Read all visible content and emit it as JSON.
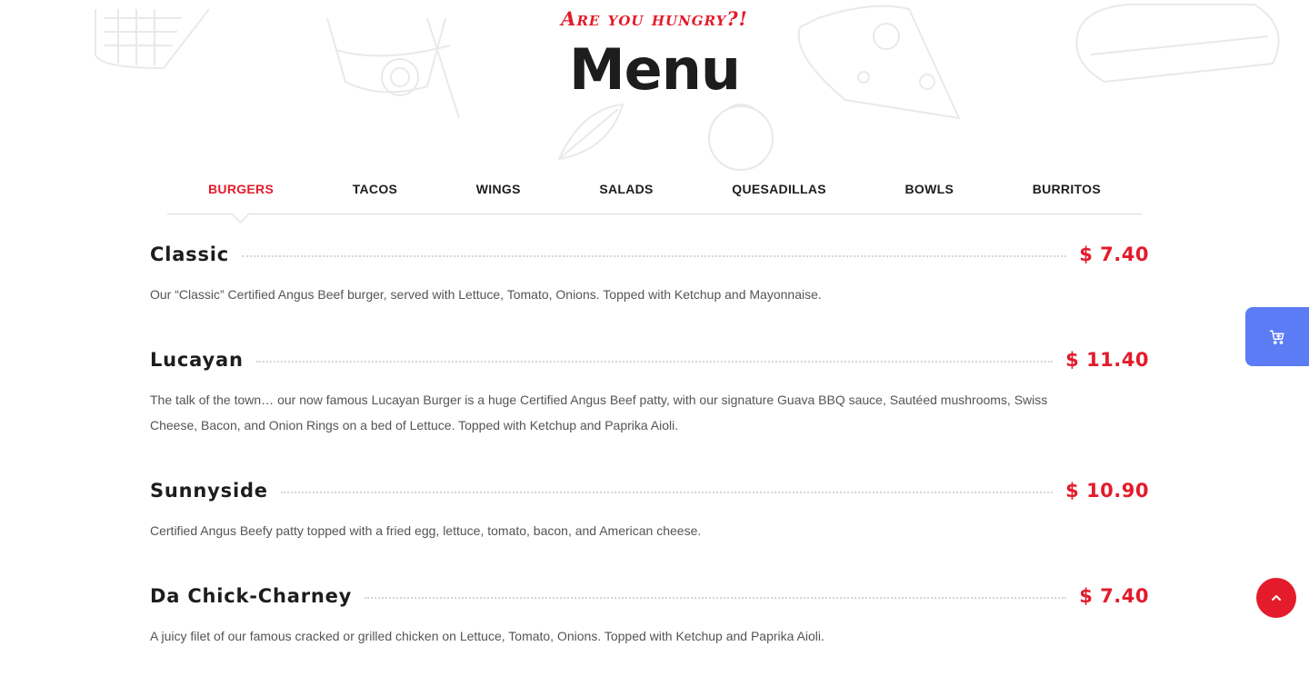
{
  "header": {
    "tagline": "Are you hungry?!",
    "title": "Menu"
  },
  "tabs": [
    {
      "label": "BURGERS",
      "active": true
    },
    {
      "label": "TACOS",
      "active": false
    },
    {
      "label": "WINGS",
      "active": false
    },
    {
      "label": "SALADS",
      "active": false
    },
    {
      "label": "QUESADILLAS",
      "active": false
    },
    {
      "label": "BOWLS",
      "active": false
    },
    {
      "label": "BURRITOS",
      "active": false
    }
  ],
  "items": [
    {
      "name": "Classic",
      "price": "$ 7.40",
      "description": "Our “Classic” Certified Angus Beef burger, served with Lettuce, Tomato, Onions. Topped with Ketchup and Mayonnaise."
    },
    {
      "name": "Lucayan",
      "price": "$ 11.40",
      "description": "The talk of the town… our now famous Lucayan Burger is a huge Certified Angus Beef patty, with our signature Guava BBQ sauce, Sautéed mushrooms, Swiss Cheese, Bacon, and Onion Rings on a bed of Lettuce. Topped with Ketchup and Paprika Aioli."
    },
    {
      "name": "Sunnyside",
      "price": "$ 10.90",
      "description": "Certified Angus Beefy patty topped with a fried egg, lettuce, tomato, bacon, and American cheese."
    },
    {
      "name": "Da Chick-Charney",
      "price": "$ 7.40",
      "description": "A juicy filet of our famous cracked or grilled chicken on Lettuce, Tomato, Onions. Topped with Ketchup and Paprika Aioli."
    }
  ],
  "floating": {
    "cart_icon": "cart-add-icon",
    "scroll_top_icon": "chevron-up-icon"
  },
  "colors": {
    "accent": "#e31b2b",
    "cart": "#5b7cf5",
    "text": "#1d1d1d"
  }
}
